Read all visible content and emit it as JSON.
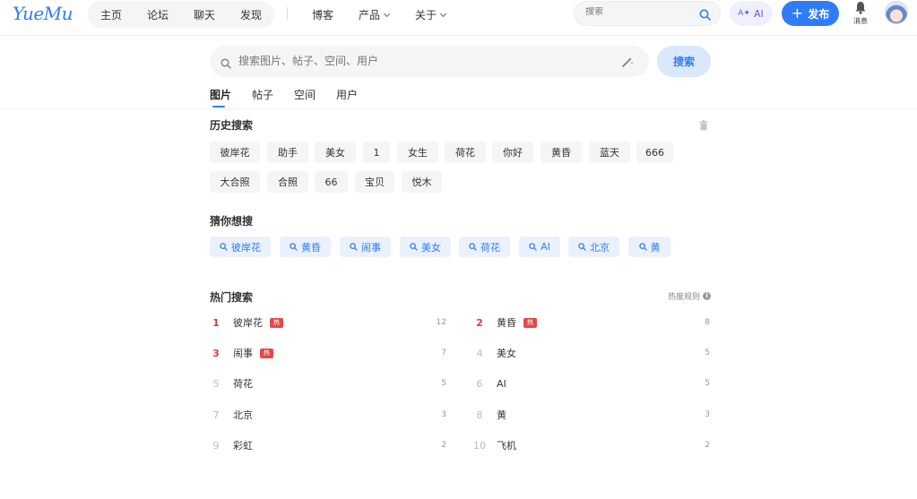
{
  "brand": {
    "logo": "YueMu",
    "accent": "#2f7cf6",
    "hot_red": "#e53935"
  },
  "header": {
    "nav": [
      "主页",
      "论坛",
      "聊天",
      "发现"
    ],
    "nav2": {
      "blog": "博客",
      "product": "产品",
      "about": "关于"
    },
    "search_placeholder": "搜索",
    "ai_label": "AI",
    "publish_label": "发布",
    "notify_label": "消息"
  },
  "search": {
    "placeholder": "搜索图片、帖子、空间、用户",
    "button": "搜索"
  },
  "tabs": [
    "图片",
    "帖子",
    "空间",
    "用户"
  ],
  "active_tab": "图片",
  "history": {
    "title": "历史搜索",
    "items": [
      "彼岸花",
      "助手",
      "美女",
      "1",
      "女生",
      "荷花",
      "你好",
      "黄昏",
      "蓝天",
      "666",
      "大合照",
      "合照",
      "66",
      "宝贝",
      "悦木"
    ]
  },
  "guess": {
    "title": "猜你想搜",
    "items": [
      "彼岸花",
      "黄昏",
      "闹事",
      "美女",
      "荷花",
      "AI",
      "北京",
      "黄"
    ]
  },
  "hot": {
    "title": "热门搜索",
    "rule_label": "热度规则",
    "badge": "热",
    "items": [
      {
        "rank": "1",
        "term": "彼岸花",
        "count": "12",
        "hot": true
      },
      {
        "rank": "2",
        "term": "黄昏",
        "count": "8",
        "hot": true
      },
      {
        "rank": "3",
        "term": "闹事",
        "count": "7",
        "hot": true
      },
      {
        "rank": "4",
        "term": "美女",
        "count": "5",
        "hot": false
      },
      {
        "rank": "5",
        "term": "荷花",
        "count": "5",
        "hot": false
      },
      {
        "rank": "6",
        "term": "AI",
        "count": "5",
        "hot": false
      },
      {
        "rank": "7",
        "term": "北京",
        "count": "3",
        "hot": false
      },
      {
        "rank": "8",
        "term": "黄",
        "count": "3",
        "hot": false
      },
      {
        "rank": "9",
        "term": "彩虹",
        "count": "2",
        "hot": false
      },
      {
        "rank": "10",
        "term": "飞机",
        "count": "2",
        "hot": false
      }
    ]
  }
}
